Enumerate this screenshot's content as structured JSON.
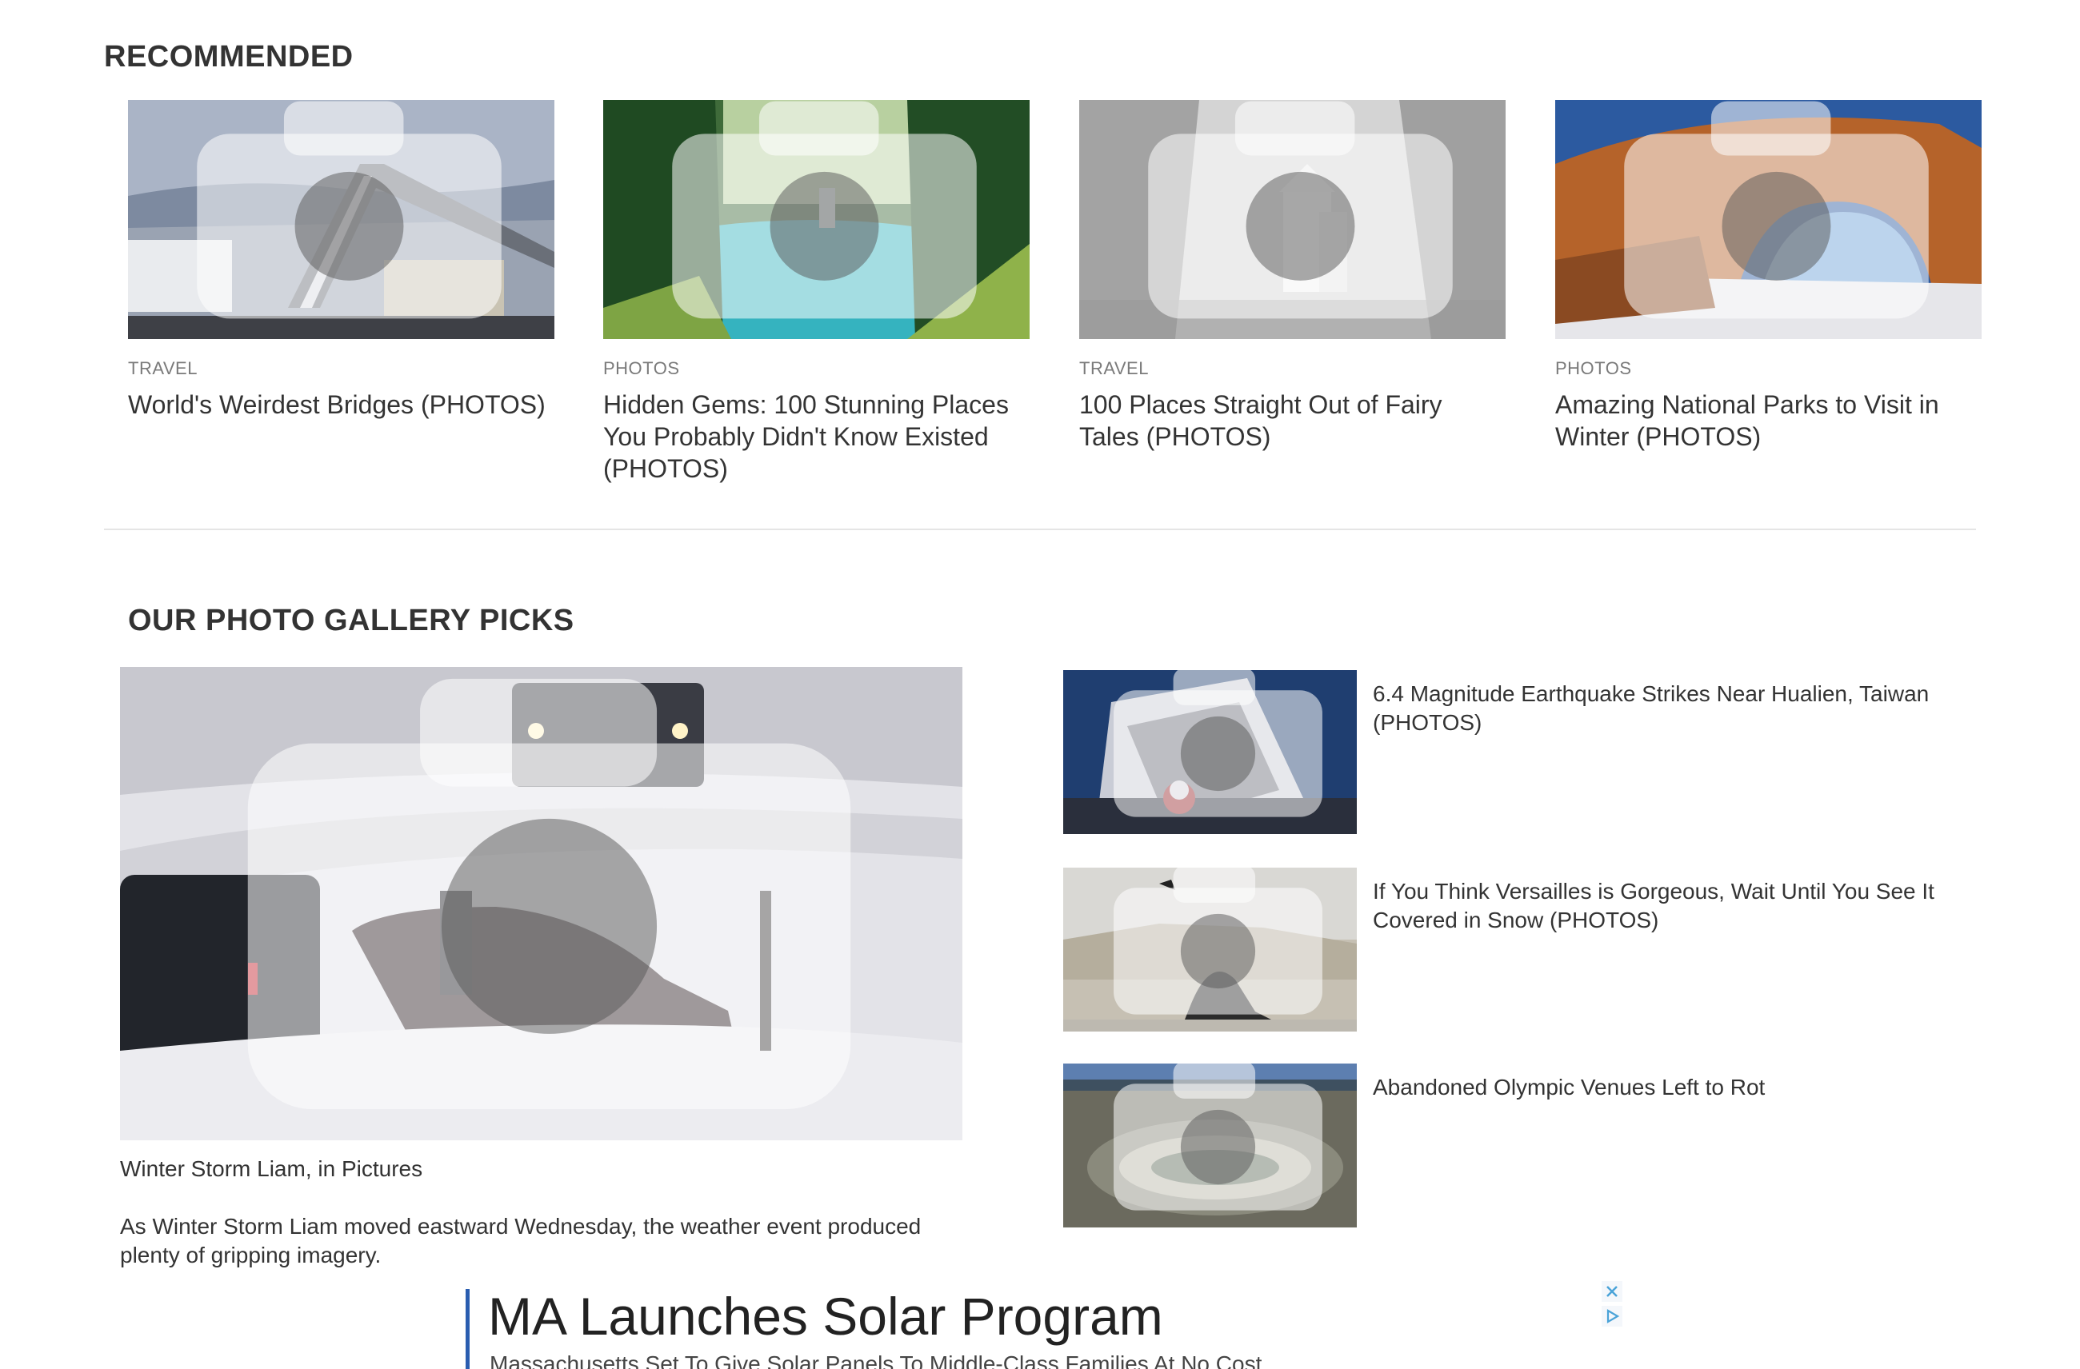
{
  "recommended": {
    "heading": "RECOMMENDED",
    "items": [
      {
        "category": "TRAVEL",
        "title": "World's Weirdest Bridges (PHOTOS)"
      },
      {
        "category": "PHOTOS",
        "title": "Hidden Gems: 100 Stunning Places You Probably Didn't Know Existed (PHOTOS)"
      },
      {
        "category": "TRAVEL",
        "title": "100 Places Straight Out of Fairy Tales (PHOTOS)"
      },
      {
        "category": "PHOTOS",
        "title": "Amazing National Parks to Visit in Winter (PHOTOS)"
      }
    ]
  },
  "gallery": {
    "heading": "OUR PHOTO GALLERY PICKS",
    "main": {
      "caption": "Winter Storm Liam, in Pictures",
      "description": "As Winter Storm Liam moved eastward Wednesday, the weather event produced plenty of gripping imagery."
    },
    "side": [
      {
        "title": "6.4 Magnitude Earthquake Strikes Near Hualien, Taiwan (PHOTOS)"
      },
      {
        "title": "If You Think Versailles is Gorgeous, Wait Until You See It Covered in Snow (PHOTOS)"
      },
      {
        "title": "Abandoned Olympic Venues Left to Rot"
      }
    ]
  },
  "ad": {
    "headline": "MA Launches Solar Program",
    "subline": "Massachusetts Set To Give Solar Panels To Middle-Class Families At No Cost"
  },
  "icons": {
    "photo": "camera-icon",
    "close": "close-icon",
    "adchoices": "adchoices-icon"
  },
  "colors": {
    "text": "#333333",
    "category": "#7a7a7a",
    "divider": "#e5e5e5",
    "ad_accent": "#2a5db0"
  }
}
